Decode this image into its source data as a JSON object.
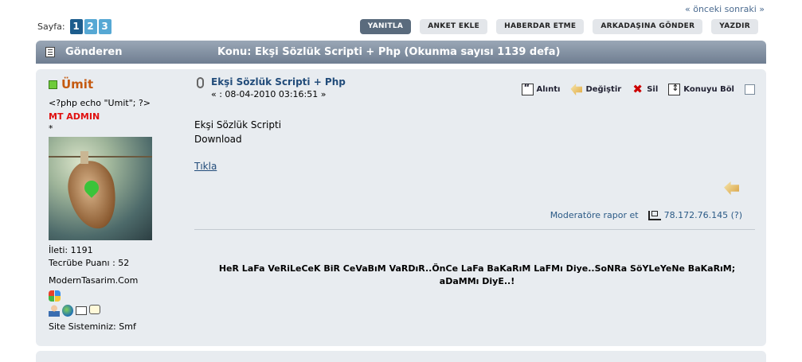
{
  "nav": {
    "prev_next": "« önceki sonraki »"
  },
  "pagination": {
    "label": "Sayfa:",
    "pages": [
      "1",
      "2",
      "3"
    ],
    "current": "1"
  },
  "toolbar": {
    "reply": "YANITLA",
    "add_poll": "ANKET EKLE",
    "notify": "HABERDAR ETME",
    "send_to_friend": "ARKADAŞINA GÖNDER",
    "print": "YAZDIR"
  },
  "header": {
    "author_col": "Gönderen",
    "topic": "Konu: Ekşi Sözlük Scripti + Php  (Okunma sayısı 1139 defa)"
  },
  "poster": {
    "name": "Ümit",
    "custom_title": "<?php echo \"Umit\"; ?>",
    "rank": "MT ADMIN",
    "stars": "*",
    "posts": "İleti: 1191",
    "karma": "Tecrübe Puanı : 52",
    "website": "ModernTasarim.Com",
    "site_system": "Site Sisteminiz: Smf"
  },
  "post": {
    "subject": "Ekşi Sözlük Scripti + Php",
    "date": "« : 08-04-2010 03:16:51 »",
    "actions": {
      "quote": "Alıntı",
      "modify": "Değiştir",
      "delete": "Sil",
      "split": "Konuyu Böl"
    },
    "body_lines": [
      "Ekşi Sözlük Scripti",
      "Download"
    ],
    "link": "Tıkla",
    "report": "Moderatöre rapor et",
    "ip": "78.172.76.145 (?)",
    "signature": "HeR LaFa VeRiLeCeK BiR CeVaBıM VaRDıR..ÖnCe LaFa BaKaRıM LaFMı Diye..SoNRa SöYLeYeNe BaKaRıM; aDaMMı DiyE..!"
  },
  "colors": {
    "header_bar": "#7f8ea1",
    "post_bg": "#e8ecf0",
    "poster_name": "#c55a11",
    "rank": "#e01010",
    "link": "#224c7a"
  }
}
